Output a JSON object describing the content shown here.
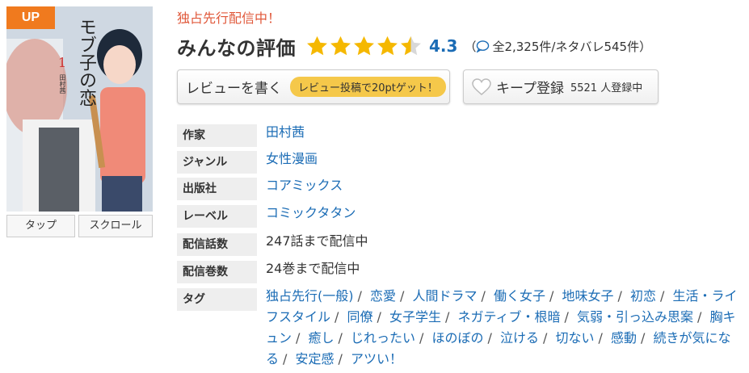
{
  "cover": {
    "badge": "UP",
    "title_vertical": "モブ子の恋",
    "volume": "1",
    "author_small": "田村茜",
    "colors": {
      "badge": "#f07a1e"
    }
  },
  "view_buttons": {
    "tap": "タップ",
    "scroll": "スクロール"
  },
  "header": {
    "exclusive_badge": "独占先行配信中！",
    "rating_title": "みんなの評価",
    "rating": 4.3,
    "score_text": "4.3",
    "counts_text": "全2,325件/ネタバレ545件",
    "paren_open": "（",
    "paren_close": "）"
  },
  "actions": {
    "write_review": "レビューを書く",
    "review_bonus": "レビュー投稿で20ptゲット！",
    "keep": "キープ登録",
    "keep_count": "5521 人登録中"
  },
  "details": [
    {
      "label": "作家",
      "value": "田村茜",
      "link": true
    },
    {
      "label": "ジャンル",
      "value": "女性漫画",
      "link": true
    },
    {
      "label": "出版社",
      "value": "コアミックス",
      "link": true
    },
    {
      "label": "レーベル",
      "value": "コミックタタン",
      "link": true
    },
    {
      "label": "配信話数",
      "value": "247話まで配信中",
      "link": false
    },
    {
      "label": "配信巻数",
      "value": "24巻まで配信中",
      "link": false
    }
  ],
  "tags_label": "タグ",
  "tags": [
    "独占先行(一般)",
    "恋愛",
    "人間ドラマ",
    "働く女子",
    "地味女子",
    "初恋",
    "生活・ライフスタイル",
    "同僚",
    "女子学生",
    "ネガティブ・根暗",
    "気弱・引っ込み思案",
    "胸キュン",
    "癒し",
    "じれったい",
    "ほのぼの",
    "泣ける",
    "切ない",
    "感動",
    "続きが気になる",
    "安定感",
    "アツい！"
  ],
  "colors": {
    "link": "#1b6cb5",
    "star": "#f5b800",
    "badge_text": "#e0583a",
    "pill": "#f5c84a"
  },
  "icons": {
    "star": "star-icon",
    "comment": "comment-bubble-icon",
    "heart": "heart-icon"
  }
}
